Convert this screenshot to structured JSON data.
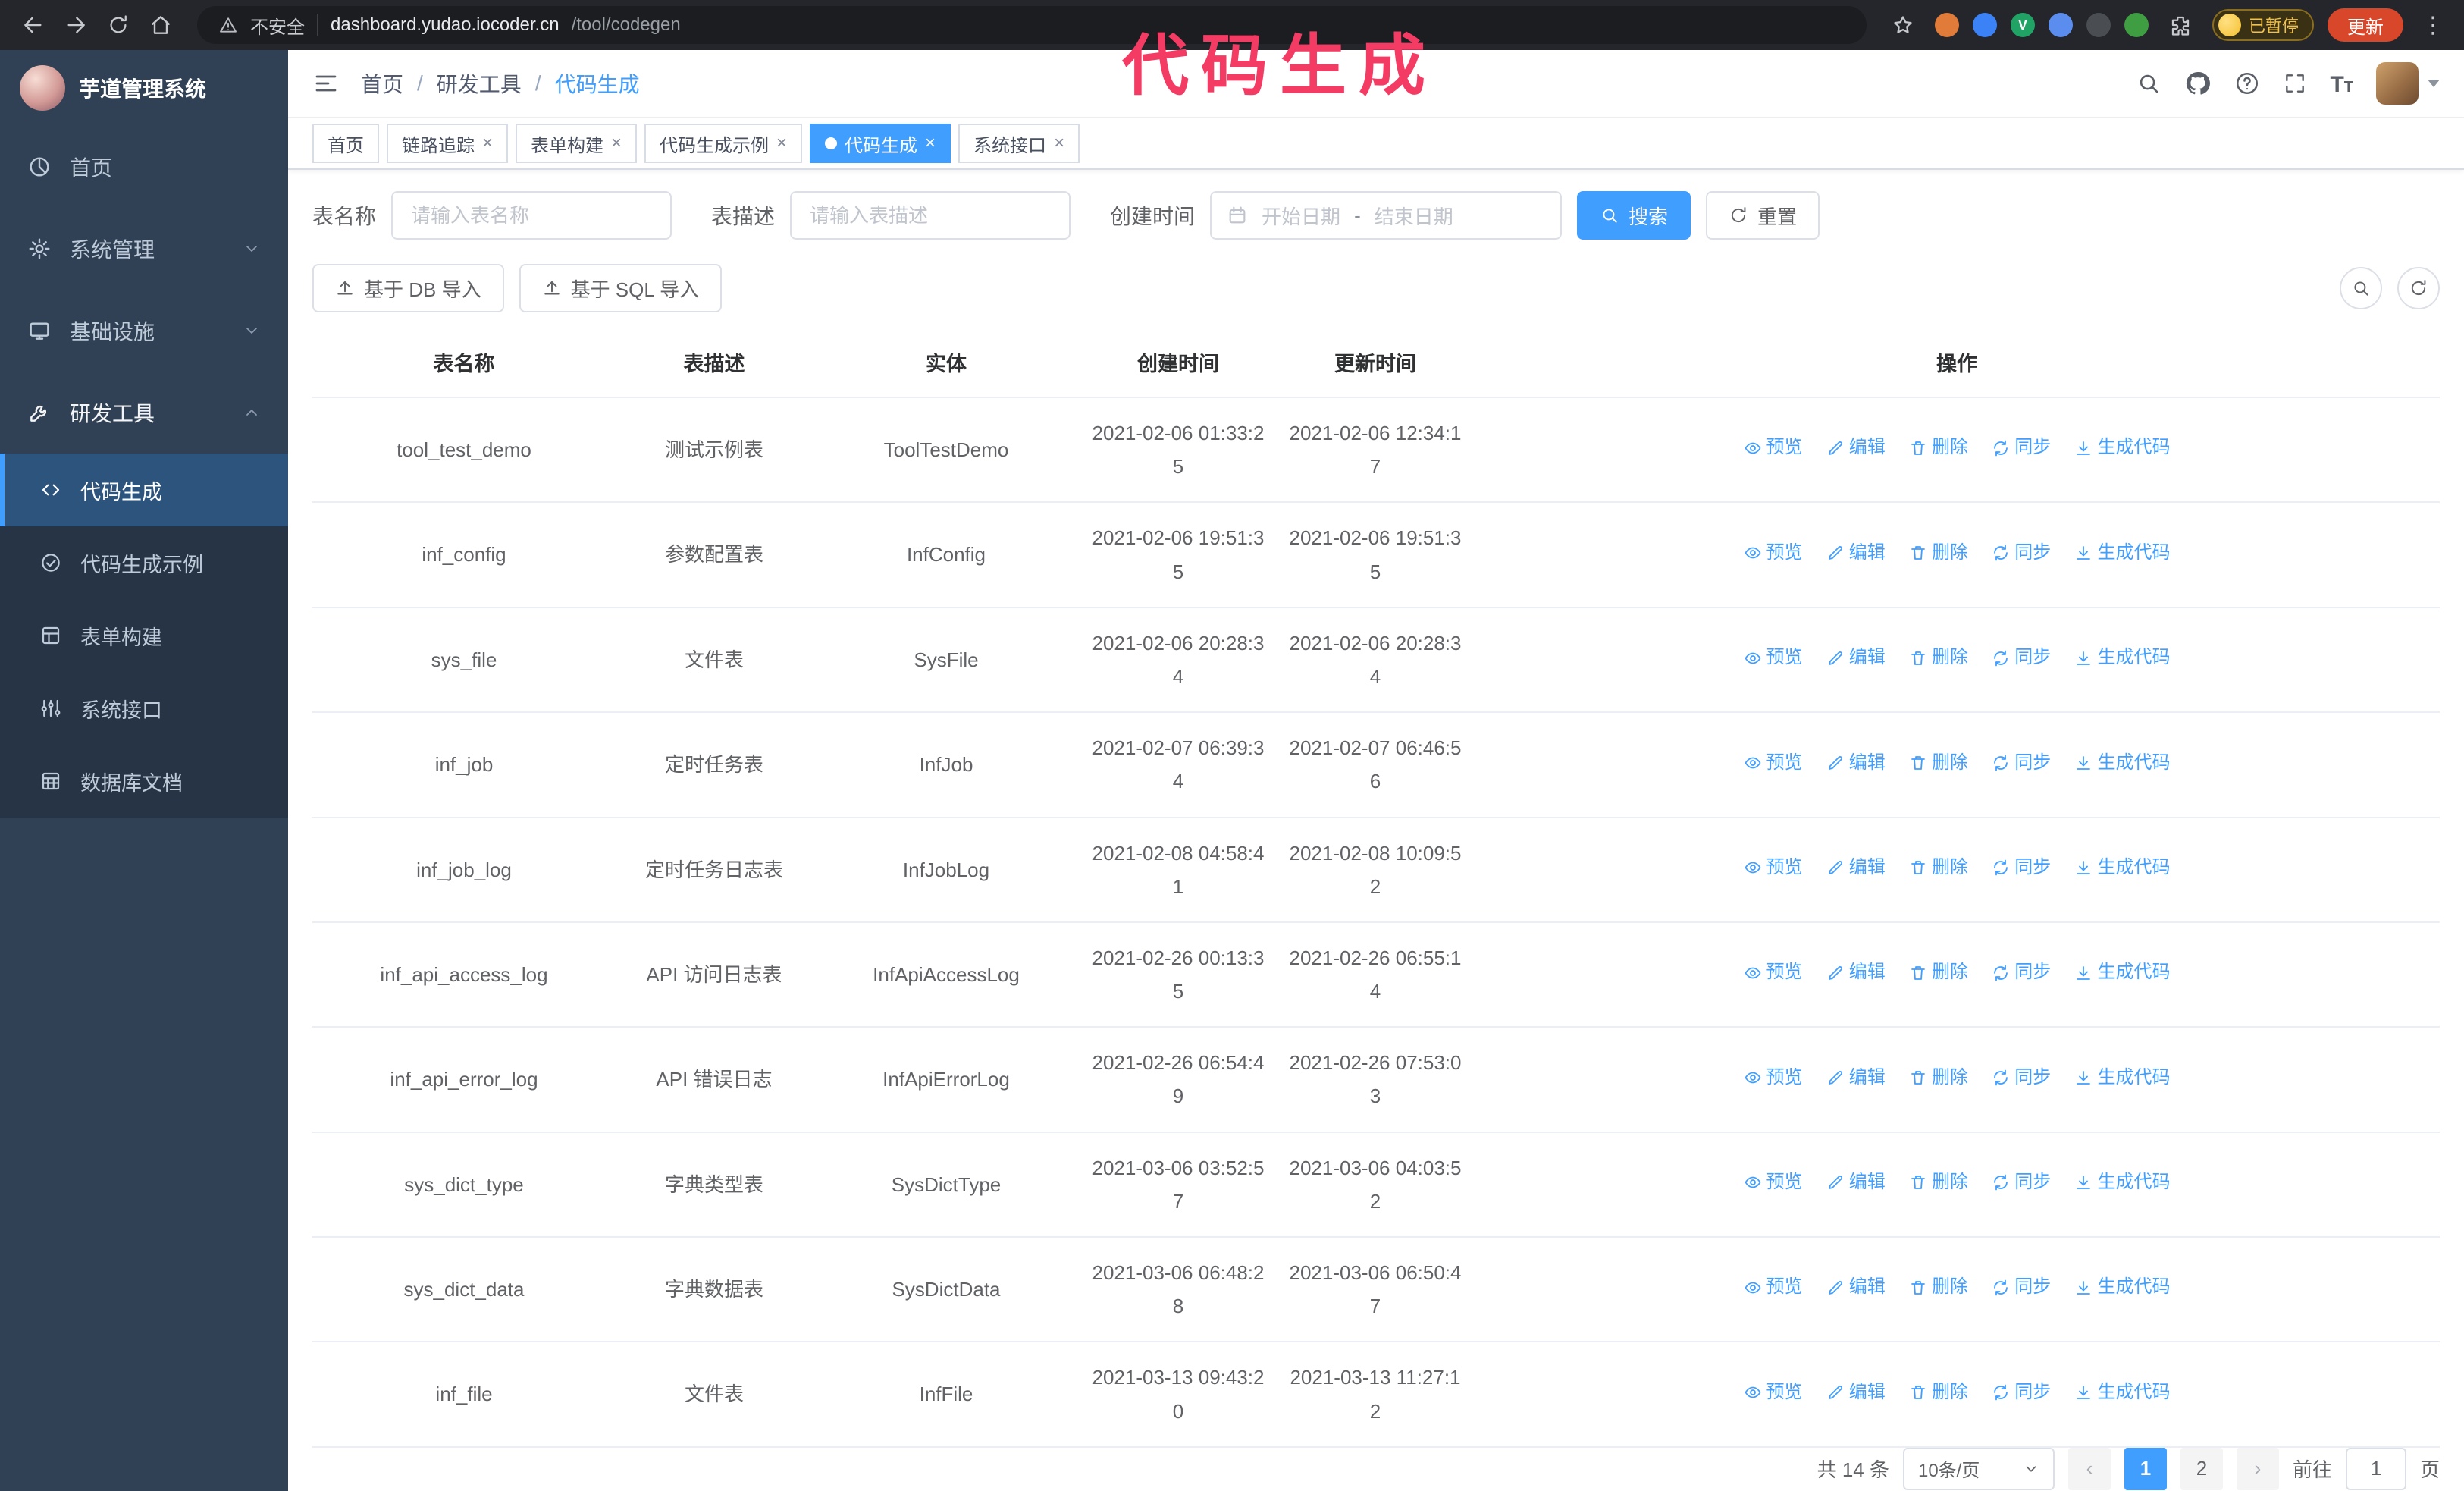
{
  "annotation": {
    "text": "代码生成",
    "color": "#f43b63"
  },
  "browser": {
    "security_warning": "不安全",
    "url_host": "dashboard.yudao.iocoder.cn",
    "url_path": "/tool/codegen",
    "paused_badge": "已暂停",
    "update_button": "更新",
    "menu_glyph": "⋮"
  },
  "sidebar": {
    "app_title": "芋道管理系统",
    "items": [
      {
        "label": "首页"
      },
      {
        "label": "系统管理"
      },
      {
        "label": "基础设施"
      },
      {
        "label": "研发工具"
      }
    ],
    "subitems": [
      {
        "label": "代码生成",
        "active": true
      },
      {
        "label": "代码生成示例"
      },
      {
        "label": "表单构建"
      },
      {
        "label": "系统接口"
      },
      {
        "label": "数据库文档"
      }
    ]
  },
  "header": {
    "breadcrumb": [
      "首页",
      "研发工具",
      "代码生成"
    ],
    "breadcrumb_sep": "/"
  },
  "tabs": [
    {
      "label": "首页",
      "closable": false,
      "active": false
    },
    {
      "label": "链路追踪",
      "closable": true,
      "active": false
    },
    {
      "label": "表单构建",
      "closable": true,
      "active": false
    },
    {
      "label": "代码生成示例",
      "closable": true,
      "active": false
    },
    {
      "label": "代码生成",
      "closable": true,
      "active": true
    },
    {
      "label": "系统接口",
      "closable": true,
      "active": false
    }
  ],
  "ui": {
    "close": "×"
  },
  "filters": {
    "table_name_label": "表名称",
    "table_name_placeholder": "请输入表名称",
    "table_desc_label": "表描述",
    "table_desc_placeholder": "请输入表描述",
    "create_time_label": "创建时间",
    "start_placeholder": "开始日期",
    "range_separator": "-",
    "end_placeholder": "结束日期",
    "search_label": "搜索",
    "reset_label": "重置"
  },
  "toolbar": {
    "import_db_label": "基于 DB 导入",
    "import_sql_label": "基于 SQL 导入"
  },
  "table": {
    "columns": [
      "表名称",
      "表描述",
      "实体",
      "创建时间",
      "更新时间",
      "操作"
    ],
    "actions": [
      "预览",
      "编辑",
      "删除",
      "同步",
      "生成代码"
    ],
    "rows": [
      {
        "name": "tool_test_demo",
        "desc": "测试示例表",
        "entity": "ToolTestDemo",
        "created": "2021-02-06 01:33:25",
        "updated": "2021-02-06 12:34:17"
      },
      {
        "name": "inf_config",
        "desc": "参数配置表",
        "entity": "InfConfig",
        "created": "2021-02-06 19:51:35",
        "updated": "2021-02-06 19:51:35"
      },
      {
        "name": "sys_file",
        "desc": "文件表",
        "entity": "SysFile",
        "created": "2021-02-06 20:28:34",
        "updated": "2021-02-06 20:28:34"
      },
      {
        "name": "inf_job",
        "desc": "定时任务表",
        "entity": "InfJob",
        "created": "2021-02-07 06:39:34",
        "updated": "2021-02-07 06:46:56"
      },
      {
        "name": "inf_job_log",
        "desc": "定时任务日志表",
        "entity": "InfJobLog",
        "created": "2021-02-08 04:58:41",
        "updated": "2021-02-08 10:09:52"
      },
      {
        "name": "inf_api_access_log",
        "desc": "API 访问日志表",
        "entity": "InfApiAccessLog",
        "created": "2021-02-26 00:13:35",
        "updated": "2021-02-26 06:55:14"
      },
      {
        "name": "inf_api_error_log",
        "desc": "API 错误日志",
        "entity": "InfApiErrorLog",
        "created": "2021-02-26 06:54:49",
        "updated": "2021-02-26 07:53:03"
      },
      {
        "name": "sys_dict_type",
        "desc": "字典类型表",
        "entity": "SysDictType",
        "created": "2021-03-06 03:52:57",
        "updated": "2021-03-06 04:03:52"
      },
      {
        "name": "sys_dict_data",
        "desc": "字典数据表",
        "entity": "SysDictData",
        "created": "2021-03-06 06:48:28",
        "updated": "2021-03-06 06:50:47"
      },
      {
        "name": "inf_file",
        "desc": "文件表",
        "entity": "InfFile",
        "created": "2021-03-13 09:43:20",
        "updated": "2021-03-13 11:27:12"
      }
    ]
  },
  "pagination": {
    "total": "共 14 条",
    "page_size": "10条/页",
    "prev": "‹",
    "next": "›",
    "pages": [
      "1",
      "2"
    ],
    "goto_label": "前往",
    "goto_value": "1",
    "page_unit": "页"
  }
}
